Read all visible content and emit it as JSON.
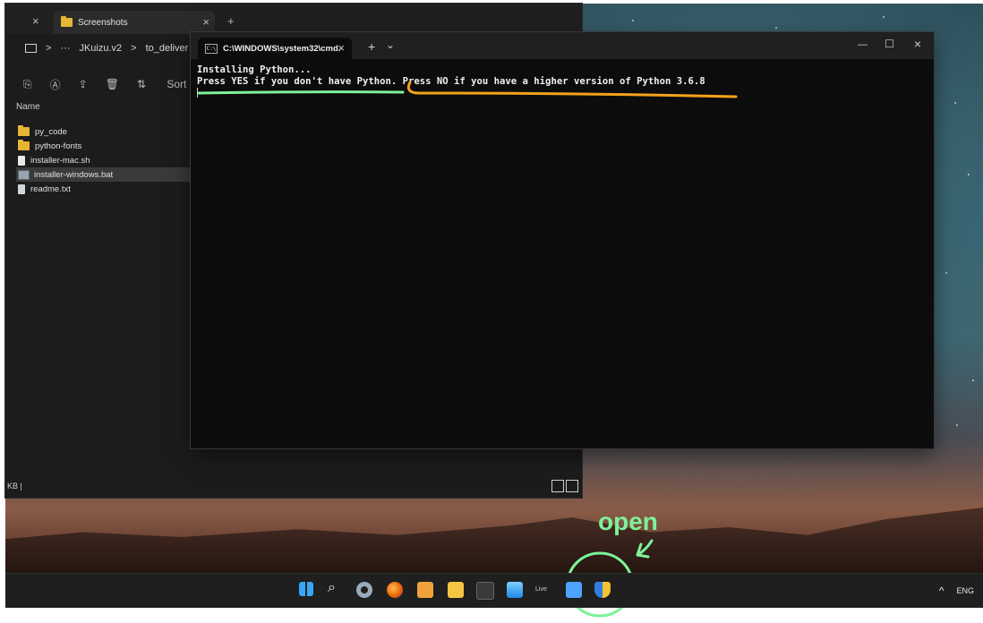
{
  "explorer": {
    "tab_title": "Screenshots",
    "tab_close": "×",
    "new_tab": "+",
    "window_close": "×",
    "breadcrumb": {
      "sep": ">",
      "more": "···",
      "part1": "JKuizu.v2",
      "part2": "to_deliver"
    },
    "toolbar": {
      "sort_label": "Sort"
    },
    "column_name": "Name",
    "files": [
      {
        "name": "py_code",
        "kind": "folder"
      },
      {
        "name": "python-fonts",
        "kind": "folder"
      },
      {
        "name": "installer-mac.sh",
        "kind": "file"
      },
      {
        "name": "installer-windows.bat",
        "kind": "bat"
      },
      {
        "name": "readme.txt",
        "kind": "text"
      }
    ],
    "status_text": "KB |"
  },
  "terminal": {
    "tab_title": "C:\\WINDOWS\\system32\\cmd.",
    "tab_close": "×",
    "new_tab": "+",
    "dropdown": "⌄",
    "controls": {
      "minimize": "—",
      "maximize": "☐",
      "close": "×"
    },
    "lines": [
      "Installing Python...",
      "Press YES if you don't have Python.",
      " Press NO if you have a higher version of Python 3.6.8"
    ]
  },
  "annotations": {
    "open_label": "open",
    "green": "#7ef29a",
    "orange": "#f5a21c"
  },
  "taskbar": {
    "tray_chevron": "^",
    "language": "ENG",
    "apps": [
      "start",
      "search",
      "settings",
      "firefox",
      "sublime",
      "file-explorer",
      "terminal",
      "photos",
      "live",
      "notepad",
      "uac-shield"
    ],
    "live_label": "Live"
  }
}
